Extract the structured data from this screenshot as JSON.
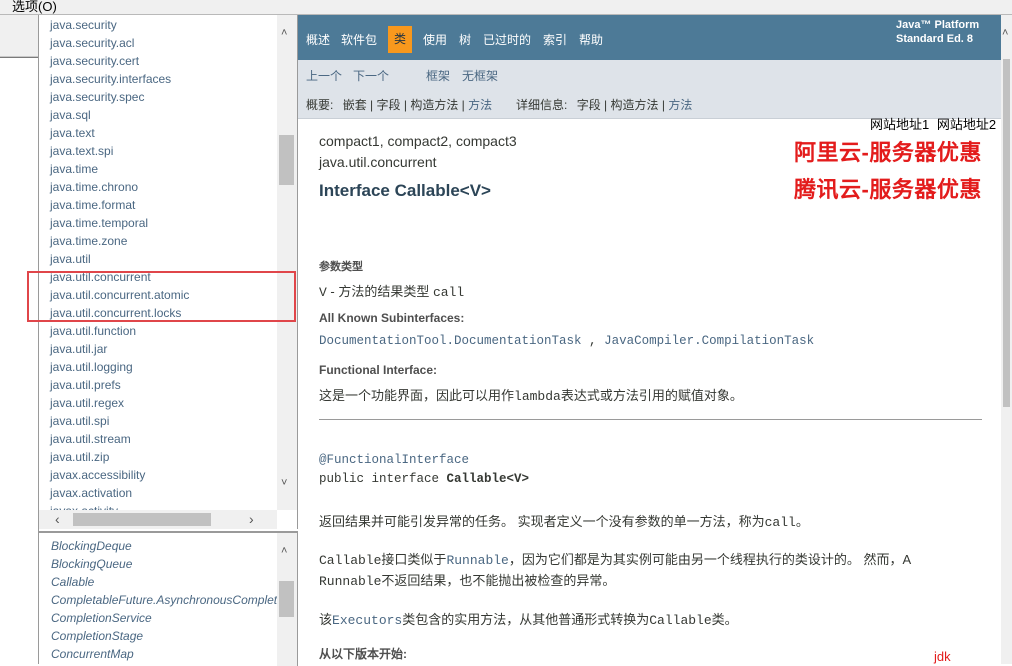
{
  "menu": {
    "label": "选项(O)"
  },
  "packages": [
    "java.security",
    "java.security.acl",
    "java.security.cert",
    "java.security.interfaces",
    "java.security.spec",
    "java.sql",
    "java.text",
    "java.text.spi",
    "java.time",
    "java.time.chrono",
    "java.time.format",
    "java.time.temporal",
    "java.time.zone",
    "java.util",
    "java.util.concurrent",
    "java.util.concurrent.atomic",
    "java.util.concurrent.locks",
    "java.util.function",
    "java.util.jar",
    "java.util.logging",
    "java.util.prefs",
    "java.util.regex",
    "java.util.spi",
    "java.util.stream",
    "java.util.zip",
    "javax.accessibility",
    "javax.activation",
    "javax.activity"
  ],
  "classes": [
    "BlockingDeque",
    "BlockingQueue",
    "Callable",
    "CompletableFuture.AsynchronousCompletionTask",
    "CompletionService",
    "CompletionStage",
    "ConcurrentMap"
  ],
  "nav": {
    "items": [
      "概述",
      "软件包",
      "类",
      "使用",
      "树",
      "已过时的",
      "索引",
      "帮助"
    ],
    "brand_line1": "Java™ Platform",
    "brand_line2": "Standard Ed. 8",
    "prev": "上一个",
    "next": "下一个",
    "frames": "框架",
    "noframes": "无框架",
    "summary_label": "概要:",
    "summary_nested": "嵌套",
    "summary_field": "字段",
    "summary_constr": "构造方法",
    "summary_method": "方法",
    "detail_label": "详细信息:",
    "detail_field": "字段",
    "detail_constr": "构造方法",
    "detail_method": "方法",
    "sep": " | "
  },
  "ads": {
    "link1": "网站地址1",
    "link2": "网站地址2",
    "aliyun": "阿里云-服务器优惠",
    "tencent": "腾讯云-服务器优惠"
  },
  "doc": {
    "profiles": "compact1, compact2, compact3",
    "package": "java.util.concurrent",
    "title": "Interface Callable<V>",
    "type_params_label": "参数类型",
    "type_param_code": "V",
    "type_param_text": " - 方法的结果类型 ",
    "type_param_call": "call",
    "subinterfaces_label": "All Known Subinterfaces:",
    "subinterface1": "DocumentationTool.DocumentationTask",
    "subinterface_sep": " , ",
    "subinterface2": "JavaCompiler.CompilationTask",
    "functional_label": "Functional Interface:",
    "functional_text_a": "这是一个功能界面，因此可以用作",
    "functional_code": "lambda",
    "functional_text_b": "表达式或方法引用的赋值对象。",
    "annotation": "@FunctionalInterface",
    "decl_prefix": "public interface ",
    "decl_name": "Callable<V>",
    "desc1_a": "返回结果并可能引发异常的任务。 实现者定义一个没有参数的单一方法，称为",
    "desc1_code": "call",
    "desc1_b": "。",
    "desc2_code1": "Callable",
    "desc2_a": "接口类似于",
    "desc2_code2": "Runnable",
    "desc2_b": "，因为它们都是为其实例可能由另一个线程执行的类设计的。 然而，A",
    "desc2_code3": "Runnable",
    "desc2_c": "不返回结果，也不能抛出被检查的异常。",
    "desc3_a": "该",
    "desc3_code1": "Executors",
    "desc3_b": "类包含的实用方法，从其他普通形式转换为",
    "desc3_code2": "Callable",
    "desc3_c": "类。",
    "since_label": "从以下版本开始:",
    "jdk_link": "jdk"
  }
}
